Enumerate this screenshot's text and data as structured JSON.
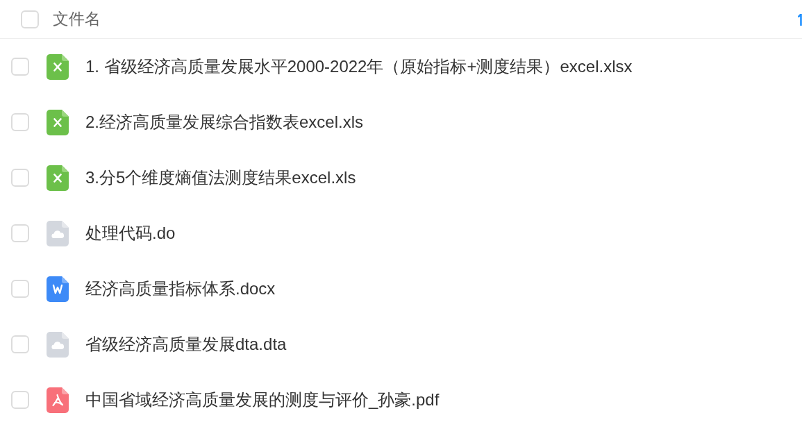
{
  "header": {
    "checked": false,
    "label": "文件名"
  },
  "files": [
    {
      "name": "1. 省级经济高质量发展水平2000-2022年（原始指标+测度结果）excel.xlsx",
      "kind": "excel",
      "checked": false
    },
    {
      "name": "2.经济高质量发展综合指数表excel.xls",
      "kind": "excel",
      "checked": false
    },
    {
      "name": "3.分5个维度熵值法测度结果excel.xls",
      "kind": "excel",
      "checked": false
    },
    {
      "name": "处理代码.do",
      "kind": "other",
      "checked": false
    },
    {
      "name": "经济高质量指标体系.docx",
      "kind": "word",
      "checked": false
    },
    {
      "name": "省级经济高质量发展dta.dta",
      "kind": "other",
      "checked": false
    },
    {
      "name": "中国省域经济高质量发展的测度与评价_孙豪.pdf",
      "kind": "pdf",
      "checked": false
    }
  ]
}
